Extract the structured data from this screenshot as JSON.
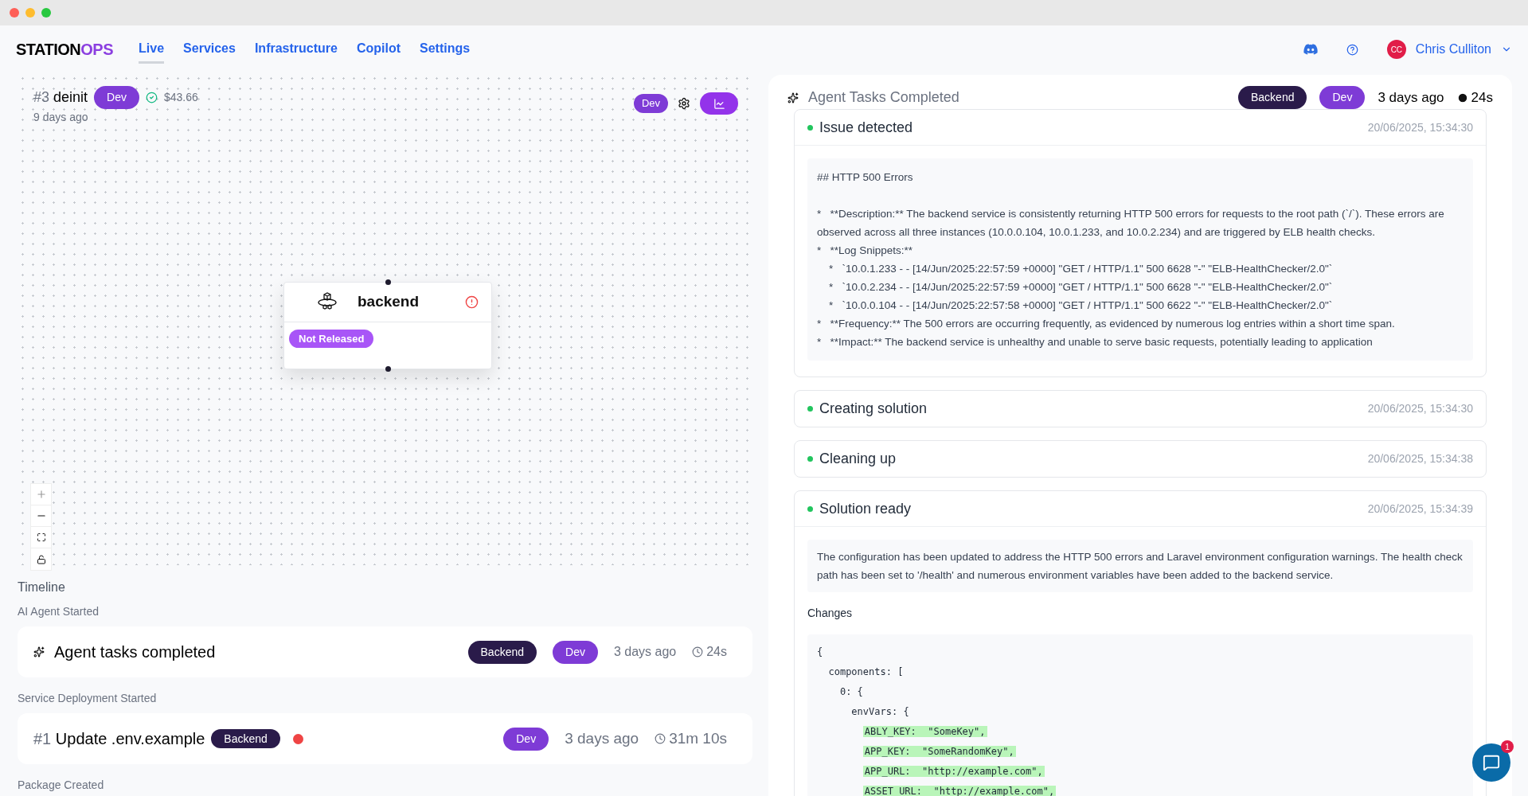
{
  "header": {
    "logo_main": "STATION",
    "logo_accent": "OPS",
    "nav": [
      {
        "label": "Live",
        "selected": true
      },
      {
        "label": "Services",
        "selected": false
      },
      {
        "label": "Infrastructure",
        "selected": false
      },
      {
        "label": "Copilot",
        "selected": false
      },
      {
        "label": "Settings",
        "selected": false
      }
    ],
    "user": {
      "initials": "CC",
      "name": "Chris Culliton"
    }
  },
  "canvas": {
    "number": "#3",
    "name": "deinit",
    "env": "Dev",
    "cost": "$43.66",
    "age": "9 days ago",
    "toolbar_env": "Dev",
    "node": {
      "title": "backend",
      "status": "Not Released",
      "error": true
    }
  },
  "timeline": {
    "title": "Timeline",
    "groups": [
      {
        "heading": "AI Agent Started",
        "item": {
          "kind": "agent",
          "title": "Agent tasks completed",
          "service": "Backend",
          "env": "Dev",
          "age": "3 days ago",
          "duration": "24s"
        }
      },
      {
        "heading": "Service Deployment Started",
        "item": {
          "kind": "deployment",
          "number": "#1",
          "title": "Update .env.example",
          "service": "Backend",
          "env": "Dev",
          "age": "3 days ago",
          "duration": "31m 10s",
          "error": true
        }
      },
      {
        "heading": "Package Created"
      }
    ]
  },
  "panel": {
    "title": "Agent Tasks Completed",
    "service": "Backend",
    "env": "Dev",
    "age": "3 days ago",
    "duration": "24s",
    "steps": [
      {
        "title": "Issue detected",
        "time": "20/06/2025, 15:34:30",
        "expanded": true,
        "kind": "markdown",
        "lines": [
          "## HTTP 500 Errors",
          "*   **Description:** The backend service is consistently returning HTTP 500 errors for requests to the root path (`/`). These errors are observed across all three instances (10.0.0.104, 10.0.1.233, and 10.0.2.234) and are triggered by ELB health checks.",
          "*   **Log Snippets:**",
          "    *   `10.0.1.233 - - [14/Jun/2025:22:57:59 +0000] \"GET / HTTP/1.1\" 500 6628 \"-\" \"ELB-HealthChecker/2.0\"`",
          "    *   `10.0.2.234 - - [14/Jun/2025:22:57:59 +0000] \"GET / HTTP/1.1\" 500 6628 \"-\" \"ELB-HealthChecker/2.0\"`",
          "    *   `10.0.0.104 - - [14/Jun/2025:22:57:58 +0000] \"GET / HTTP/1.1\" 500 6622 \"-\" \"ELB-HealthChecker/2.0\"`",
          "*   **Frequency:** The 500 errors are occurring frequently, as evidenced by numerous log entries within a short time span.",
          "*   **Impact:** The backend service is unhealthy and unable to serve basic requests, potentially leading to application"
        ]
      },
      {
        "title": "Creating solution",
        "time": "20/06/2025, 15:34:30",
        "expanded": false
      },
      {
        "title": "Cleaning up",
        "time": "20/06/2025, 15:34:38",
        "expanded": false
      },
      {
        "title": "Solution ready",
        "time": "20/06/2025, 15:34:39",
        "expanded": true,
        "kind": "solution",
        "summary": "The configuration has been updated to address the HTTP 500 errors and Laravel environment configuration warnings. The health check path has been set to '/health' and numerous environment variables have been added to the backend service.",
        "changes_label": "Changes",
        "code": [
          {
            "text": "{",
            "highlighted": false
          },
          {
            "text": "  components: [",
            "highlighted": false
          },
          {
            "text": "    0: {",
            "highlighted": false
          },
          {
            "text": "      envVars: {",
            "highlighted": false
          },
          {
            "text": "        ABLY_KEY:  \"SomeKey\",",
            "highlighted": true
          },
          {
            "text": "        APP_KEY:  \"SomeRandomKey\",",
            "highlighted": true
          },
          {
            "text": "        APP_URL:  \"http://example.com\",",
            "highlighted": true
          },
          {
            "text": "        ASSET_URL:  \"http://example.com\",",
            "highlighted": true
          }
        ]
      }
    ]
  },
  "chat": {
    "unread": "1"
  }
}
